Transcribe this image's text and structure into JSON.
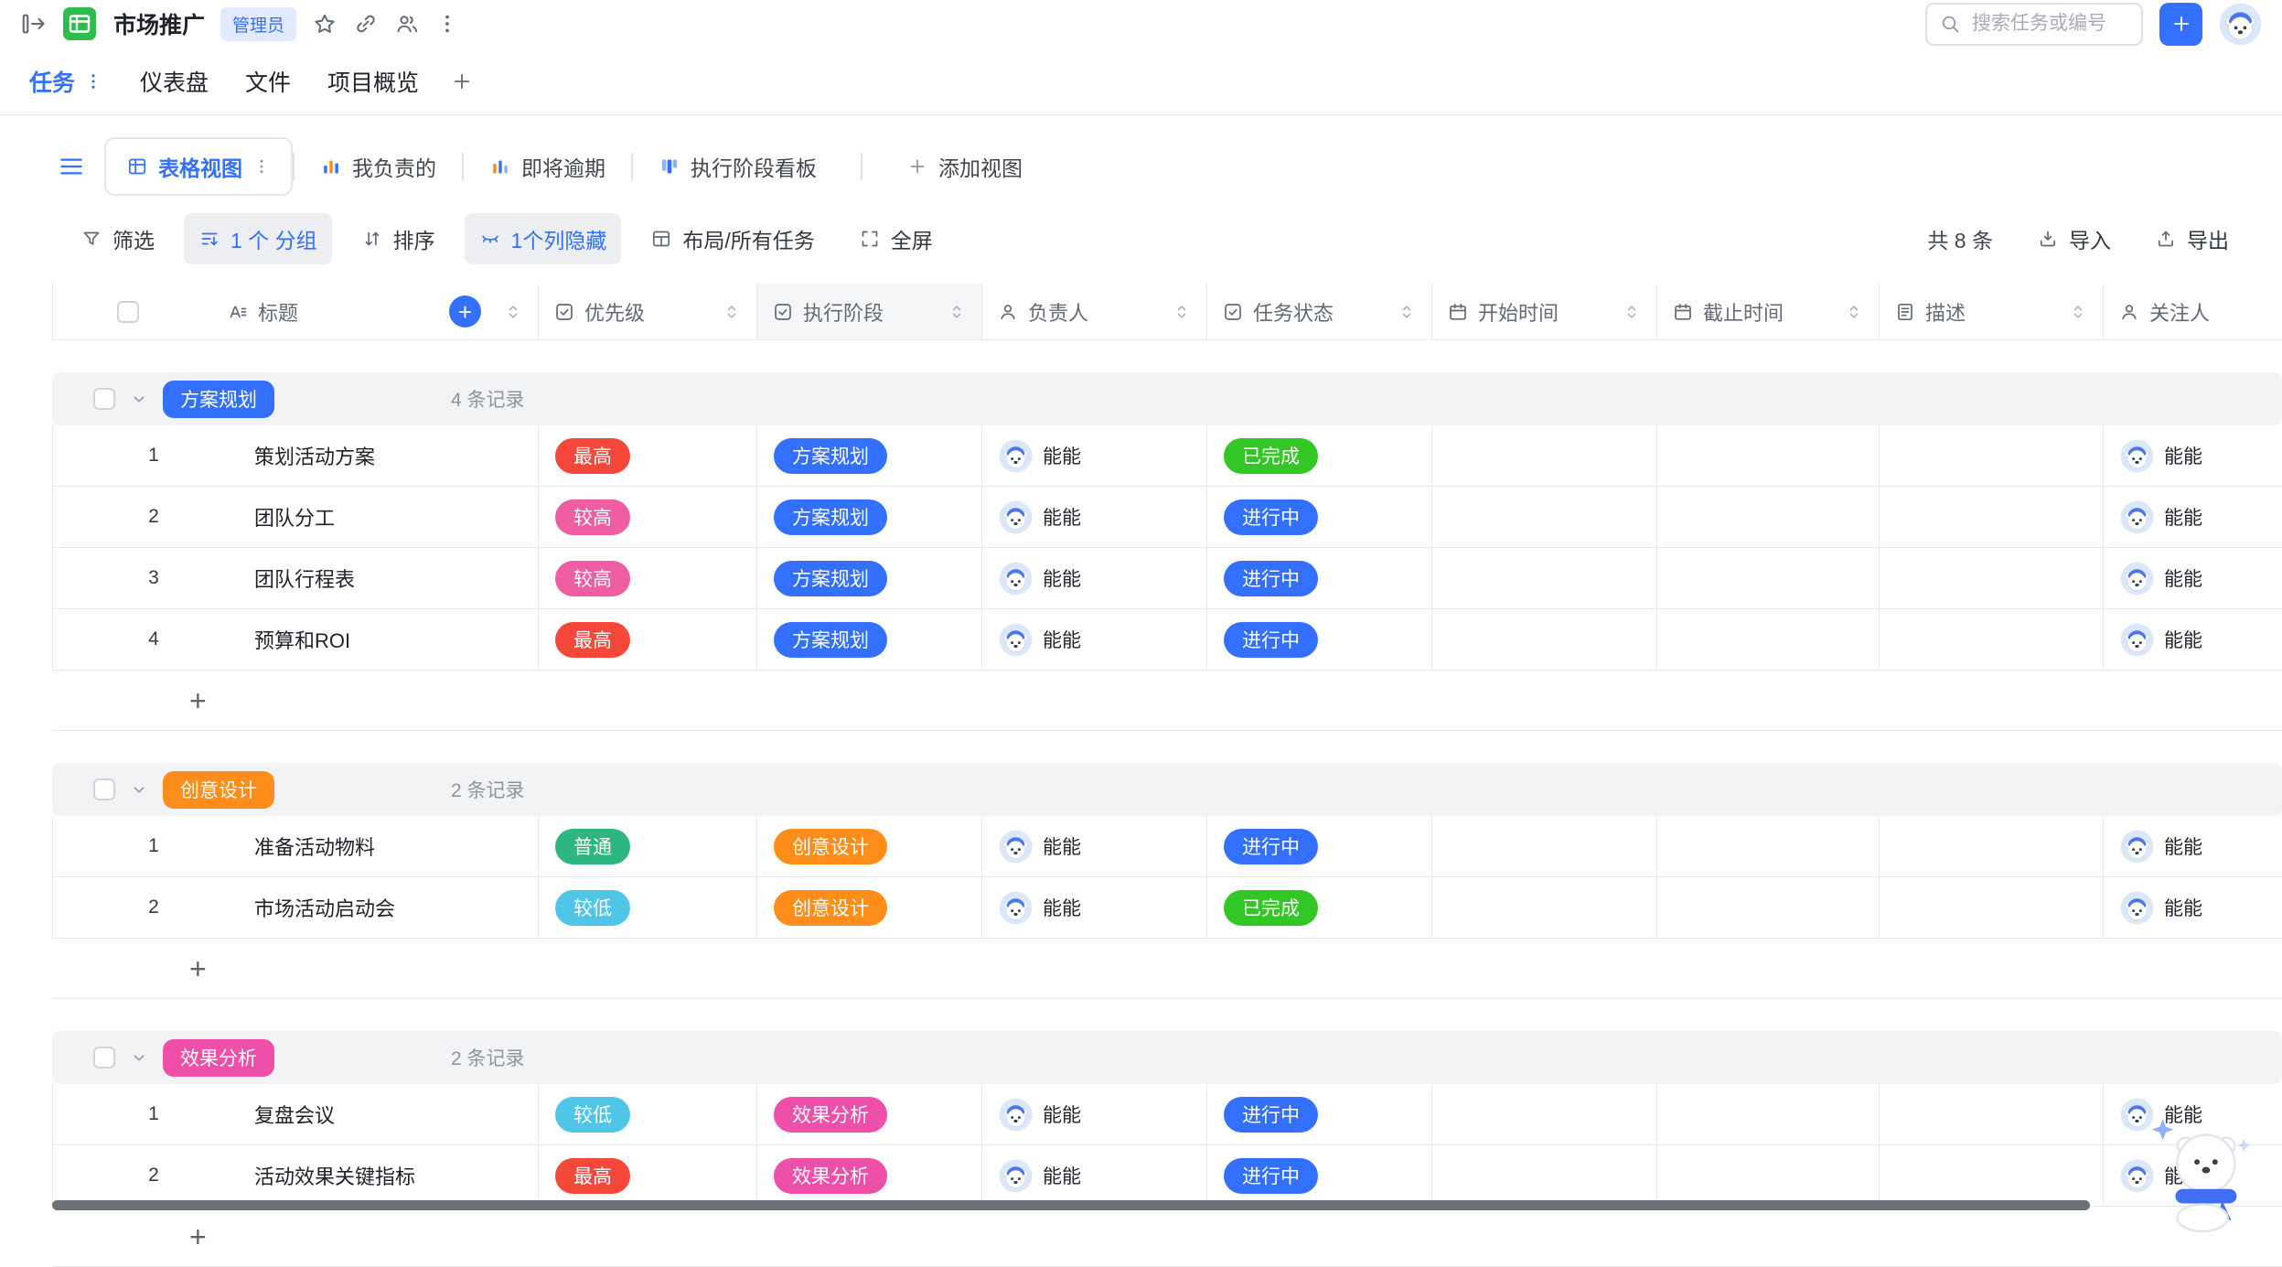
{
  "topbar": {
    "project_title": "市场推广",
    "admin_badge": "管理员",
    "search_placeholder": "搜索任务或编号"
  },
  "nav_tabs": [
    {
      "label": "任务",
      "active": true
    },
    {
      "label": "仪表盘"
    },
    {
      "label": "文件"
    },
    {
      "label": "项目概览"
    }
  ],
  "view_bar": {
    "tabs": [
      {
        "label": "表格视图",
        "icon": "grid",
        "active": true
      },
      {
        "label": "我负责的",
        "icon": "chart"
      },
      {
        "label": "即将逾期",
        "icon": "chart2"
      },
      {
        "label": "执行阶段看板",
        "icon": "kanban"
      }
    ],
    "add_view_label": "添加视图"
  },
  "toolbar": {
    "left": [
      {
        "label": "筛选",
        "icon": "filter"
      },
      {
        "label": "1 个 分组",
        "icon": "group",
        "active": true
      },
      {
        "label": "排序",
        "icon": "sort"
      },
      {
        "label": "1个列隐藏",
        "icon": "eye-off",
        "active": true
      },
      {
        "label": "布局/所有任务",
        "icon": "layout"
      },
      {
        "label": "全屏",
        "icon": "fullscreen"
      }
    ],
    "total": "共 8 条",
    "import_label": "导入",
    "export_label": "导出"
  },
  "table": {
    "columns": [
      {
        "label": "标题",
        "icon": "text"
      },
      {
        "label": "优先级",
        "icon": "select"
      },
      {
        "label": "执行阶段",
        "icon": "select",
        "highlight": true
      },
      {
        "label": "负责人",
        "icon": "person"
      },
      {
        "label": "任务状态",
        "icon": "select"
      },
      {
        "label": "开始时间",
        "icon": "calendar"
      },
      {
        "label": "截止时间",
        "icon": "calendar"
      },
      {
        "label": "描述",
        "icon": "doc"
      },
      {
        "label": "关注人",
        "icon": "person"
      }
    ],
    "groups": [
      {
        "name": "方案规划",
        "count_label": "4 条记录",
        "rows": [
          {
            "num": "1",
            "title": "策划活动方案",
            "priority": "最高",
            "stage": "方案规划",
            "owner": "能能",
            "status": "已完成",
            "follower": "能能"
          },
          {
            "num": "2",
            "title": "团队分工",
            "priority": "较高",
            "stage": "方案规划",
            "owner": "能能",
            "status": "进行中",
            "follower": "能能"
          },
          {
            "num": "3",
            "title": "团队行程表",
            "priority": "较高",
            "stage": "方案规划",
            "owner": "能能",
            "status": "进行中",
            "follower": "能能"
          },
          {
            "num": "4",
            "title": "预算和ROI",
            "priority": "最高",
            "stage": "方案规划",
            "owner": "能能",
            "status": "进行中",
            "follower": "能能"
          }
        ]
      },
      {
        "name": "创意设计",
        "count_label": "2 条记录",
        "rows": [
          {
            "num": "1",
            "title": "准备活动物料",
            "priority": "普通",
            "stage": "创意设计",
            "owner": "能能",
            "status": "进行中",
            "follower": "能能"
          },
          {
            "num": "2",
            "title": "市场活动启动会",
            "priority": "较低",
            "stage": "创意设计",
            "owner": "能能",
            "status": "已完成",
            "follower": "能能"
          }
        ]
      },
      {
        "name": "效果分析",
        "count_label": "2 条记录",
        "rows": [
          {
            "num": "1",
            "title": "复盘会议",
            "priority": "较低",
            "stage": "效果分析",
            "owner": "能能",
            "status": "进行中",
            "follower": "能能"
          },
          {
            "num": "2",
            "title": "活动效果关键指标",
            "priority": "最高",
            "stage": "效果分析",
            "owner": "能能",
            "status": "进行中",
            "follower": "能能"
          }
        ]
      }
    ]
  },
  "colors": {
    "accent": "#3370ff",
    "priority": {
      "最高": "#f5483b",
      "较高": "#ef5da2",
      "普通": "#2db77e",
      "较低": "#4fc6e8"
    },
    "stage": {
      "方案规划": "#3370ff",
      "创意设计": "#ff8d1a",
      "效果分析": "#ee4fa8"
    },
    "status": {
      "已完成": "#32c724",
      "进行中": "#3370ff"
    }
  }
}
